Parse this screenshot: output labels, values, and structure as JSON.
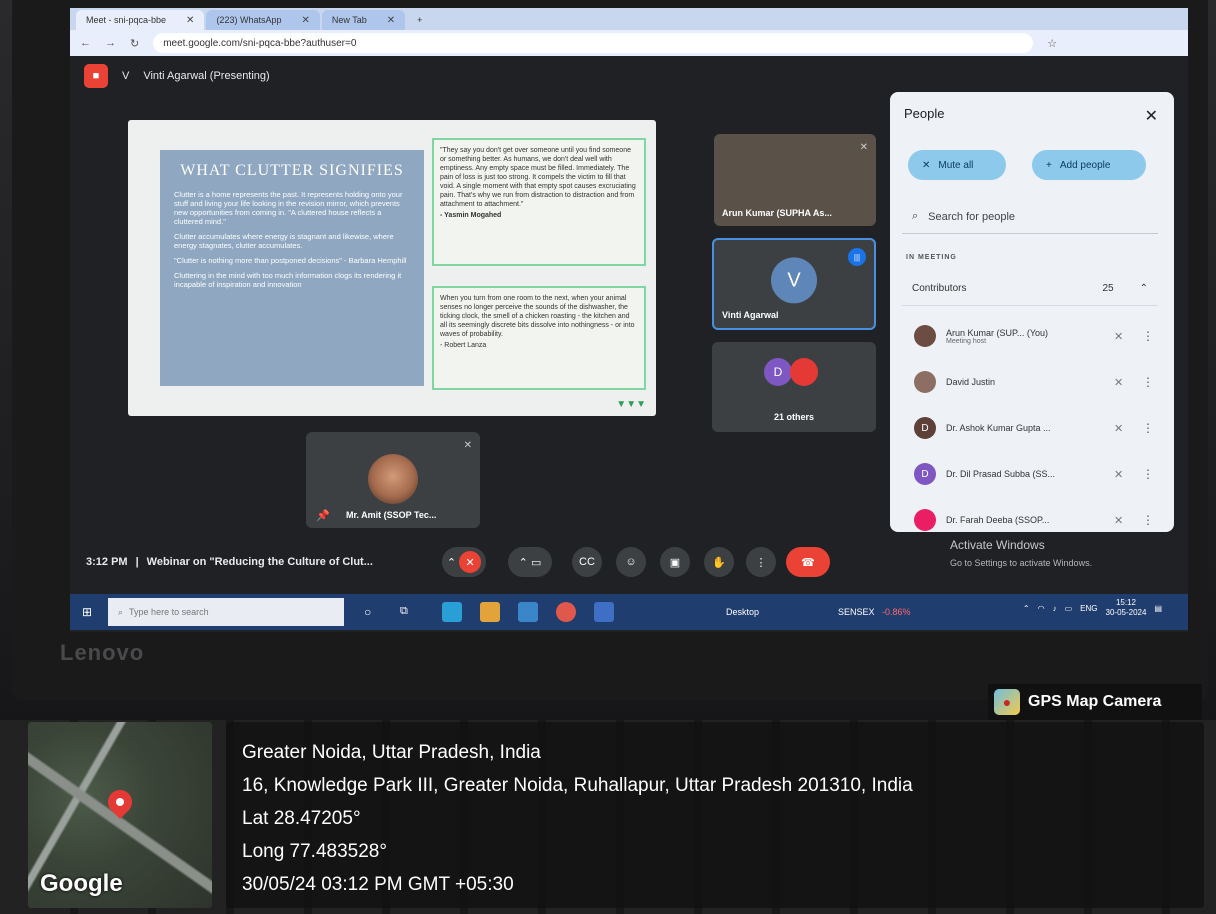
{
  "browser": {
    "tabs": [
      {
        "label": "Meet - sni-pqca-bbe"
      },
      {
        "label": "(223) WhatsApp"
      },
      {
        "label": "New Tab"
      }
    ],
    "url": "meet.google.com/sni-pqca-bbe?authuser=0"
  },
  "meet": {
    "presenter_initial": "V",
    "presenting_label": "Vinti Agarwal (Presenting)",
    "slide": {
      "title": "WHAT CLUTTER SIGNIFIES",
      "bullets": [
        "Clutter is a home represents the past. It represents holding onto your stuff and living your life looking in the revision mirror, which prevents new opportunities from coming in. \"A cluttered house reflects a cluttered mind.\"",
        "Clutter accumulates where energy is stagnant and likewise, where energy stagnates, clutter accumulates.",
        "\"Clutter is nothing more than postponed decisions\" - Barbara Hemphill",
        "Cluttering in the mind with too much information clogs its rendering it incapable of inspiration and innovation"
      ],
      "quote1": "\"They say you don't get over someone until you find someone or something better. As humans, we don't deal well with emptiness. Any empty space must be filled. Immediately. The pain of loss is just too strong. It compels the victim to fill that void. A single moment with that empty spot causes excruciating pain. That's why we run from distraction to distraction and from attachment to attachment.\"",
      "quote1_author": "- Yasmin Mogahed",
      "quote2": "When you turn from one room to the next, when your animal senses no longer perceive the sounds of the dishwasher, the ticking clock, the smell of a chicken roasting - the kitchen and all its seemingly discrete bits dissolve into nothingness - or into waves of probability.",
      "quote2_author": "- Robert Lanza"
    },
    "tiles": {
      "arun": "Arun Kumar (SUPHA As...",
      "vinti_initial": "V",
      "vinti": "Vinti Agarwal",
      "others_initial": "D",
      "others": "21 others",
      "amit": "Mr. Amit (SSOP Tec..."
    },
    "people_panel": {
      "title": "People",
      "mute_all": "Mute all",
      "add_people": "Add people",
      "search_placeholder": "Search for people",
      "section": "IN MEETING",
      "group": "Contributors",
      "count": "25",
      "participants": [
        {
          "initial": "",
          "name": "Arun Kumar (SUP...  (You)",
          "sub": "Meeting host",
          "avatar_color": "#6d4c41"
        },
        {
          "initial": "",
          "name": "David Justin",
          "sub": "",
          "avatar_color": "#8d6e63"
        },
        {
          "initial": "D",
          "name": "Dr. Ashok Kumar Gupta ...",
          "sub": "",
          "avatar_color": "#5d4037"
        },
        {
          "initial": "D",
          "name": "Dr. Dil Prasad Subba (SS...",
          "sub": "",
          "avatar_color": "#7e57c2"
        },
        {
          "initial": "",
          "name": "Dr. Farah Deeba (SSOP...",
          "sub": "",
          "avatar_color": "#e91e63"
        }
      ]
    },
    "time": "3:12 PM",
    "meeting_title": "Webinar on \"Reducing the Culture of Clut...",
    "activate_title": "Activate Windows",
    "activate_sub": "Go to Settings to activate Windows."
  },
  "taskbar": {
    "search_placeholder": "Type here to search",
    "desktop_label": "Desktop",
    "sensex_label": "SENSEX",
    "sensex_change": "-0.86%",
    "lang": "ENG",
    "clock_time": "15:12",
    "clock_date": "30-05-2024"
  },
  "laptop_brand": "Lenovo",
  "gps": {
    "app": "GPS Map Camera",
    "place": "Greater Noida, Uttar Pradesh, India",
    "address": "16, Knowledge Park III, Greater Noida, Ruhallapur, Uttar Pradesh 201310, India",
    "lat": "Lat 28.47205°",
    "long": "Long 77.483528°",
    "datetime": "30/05/24 03:12 PM GMT +05:30",
    "map_brand": "Google"
  }
}
